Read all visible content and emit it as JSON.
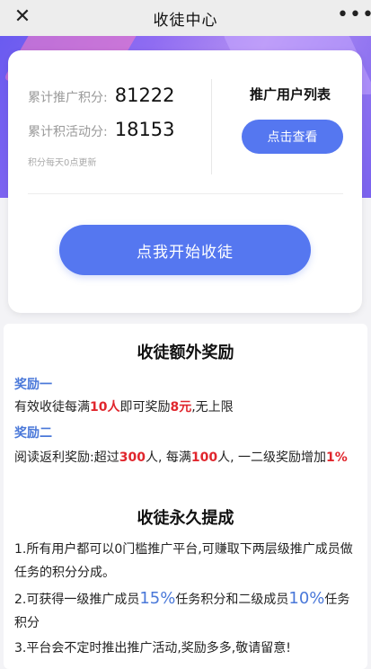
{
  "header": {
    "close_icon": "close-icon",
    "title": "收徒中心",
    "more_icon": "more-dots-icon"
  },
  "stats": {
    "total_promo_label": "累计推广积分:",
    "total_promo_value": "81222",
    "total_activity_label": "累计积活动分:",
    "total_activity_value": "18153",
    "update_note": "积分每天0点更新"
  },
  "promo_list": {
    "title": "推广用户列表",
    "button": "点击查看"
  },
  "main_button": "点我开始收徒",
  "extra_rewards": {
    "title": "收徒额外奖励",
    "reward1": {
      "heading": "奖励一",
      "t1": "有效收徒每满",
      "n1": "10人",
      "t2": "即可奖励",
      "n2": "8元",
      "t3": ",无上限"
    },
    "reward2": {
      "heading": "奖励二",
      "t1": "阅读返利奖励:超过",
      "n1": "300",
      "t2": "人, 每满",
      "n2": "100",
      "t3": "人, 一二级奖励增加",
      "n3": "1%"
    }
  },
  "permanent": {
    "title": "收徒永久提成",
    "rule1": "1.所有用户都可以0门槛推广平台,可赚取下两层级推广成员做任务的积分分成。",
    "rule2_a": "2.可获得一级推广成员",
    "rule2_p1": "15%",
    "rule2_b": "任务积分和二级成员",
    "rule2_p2": "10%",
    "rule2_c": "任务积分",
    "rule3": "3.平台会不定时推出推广活动,奖励多多,敬请留意!"
  },
  "colors": {
    "accent": "#5577f0",
    "highlight_red": "#e0262d",
    "heading_blue": "#4a78d9"
  }
}
